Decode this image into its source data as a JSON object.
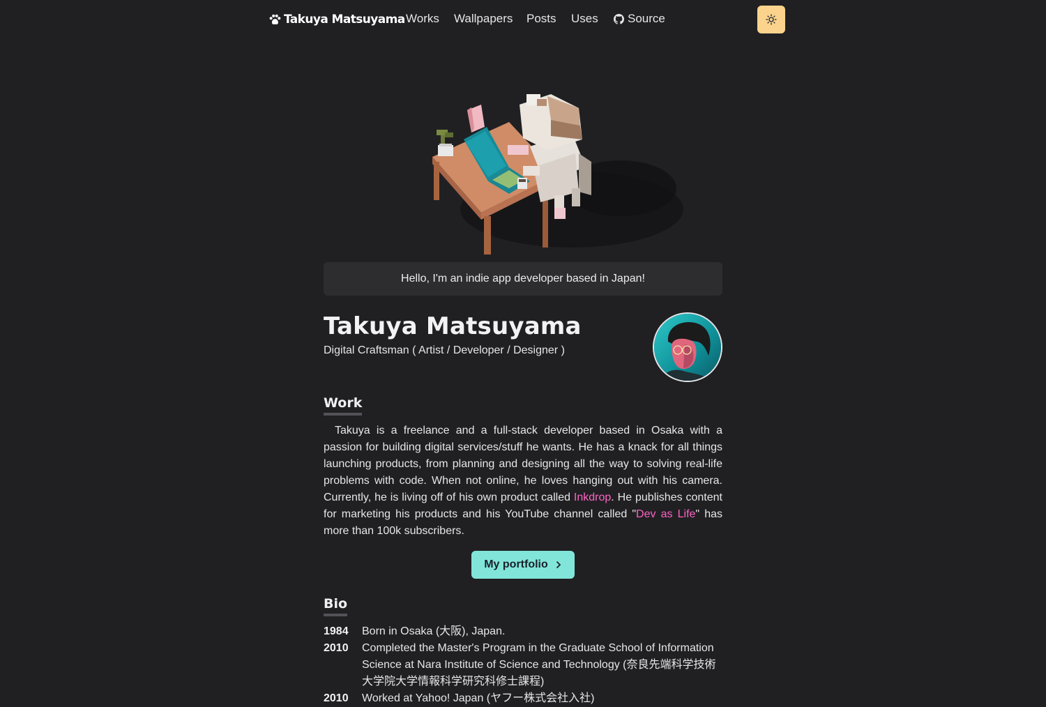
{
  "navbar": {
    "logo_text": "Takuya Matsuyama",
    "links": [
      "Works",
      "Wallpapers",
      "Posts",
      "Uses"
    ],
    "source_label": "Source",
    "theme_toggle_color": "#fbd38d"
  },
  "greeting": "Hello, I'm an indie app developer based in Japan!",
  "profile": {
    "name": "Takuya Matsuyama",
    "tagline": "Digital Craftsman ( Artist / Developer / Designer )"
  },
  "work": {
    "heading": "Work",
    "paragraph_part1": "Takuya is a freelance and a full-stack developer based in Osaka with a passion for building digital services/stuff he wants. He has a knack for all things launching products, from planning and designing all the way to solving real-life problems with code. When not online, he loves hanging out with his camera. Currently, he is living off of his own product called ",
    "link1": "Inkdrop",
    "paragraph_part2": ". He publishes content for marketing his products and his YouTube channel called \"",
    "link2": "Dev as Life",
    "paragraph_part3": "\" has more than 100k subscribers.",
    "button_label": "My portfolio"
  },
  "bio": {
    "heading": "Bio",
    "entries": [
      {
        "year": "1984",
        "text": "Born in Osaka (大阪), Japan."
      },
      {
        "year": "2010",
        "text": "Completed the Master's Program in the Graduate School of Information Science at Nara Institute of Science and Technology (奈良先端科学技術大学院大学情報科学研究科修士課程)"
      },
      {
        "year": "2010",
        "text": "Worked at Yahoo! Japan (ヤフー株式会社入社)"
      }
    ]
  },
  "colors": {
    "background": "#202023",
    "accent_link": "#ff63c3",
    "button": "#81e6d9"
  }
}
